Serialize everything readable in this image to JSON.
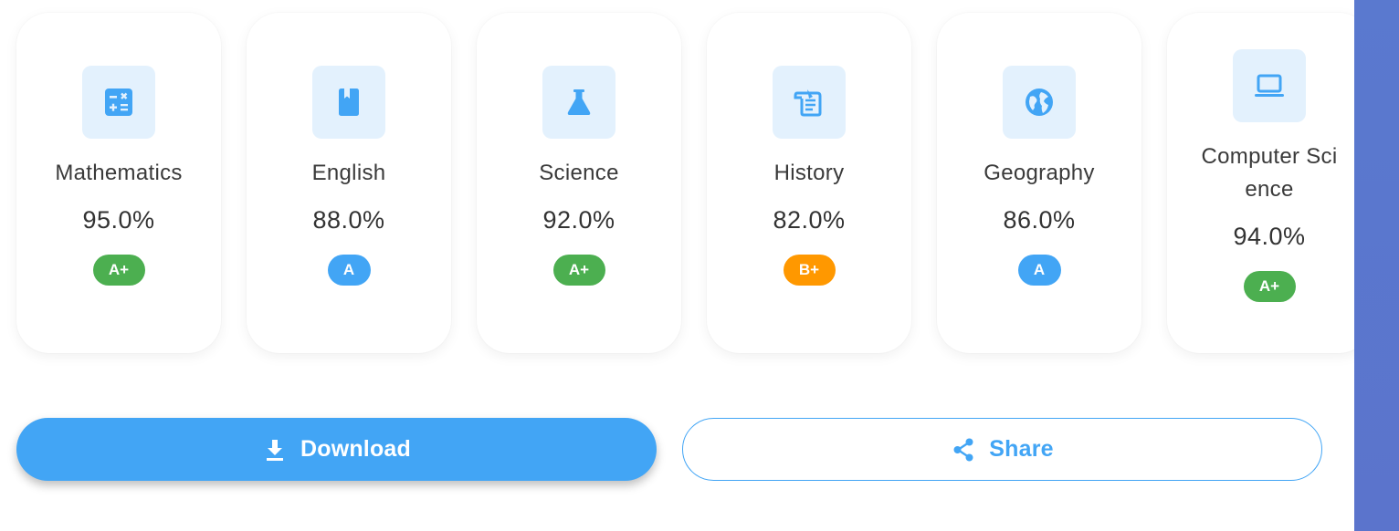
{
  "colors": {
    "accent": "#42a5f5",
    "icon_bg": "#e3f1fd",
    "grade_green": "#4caf50",
    "grade_blue": "#42a5f5",
    "grade_orange": "#ff9800",
    "side_panel": "#5a79cf"
  },
  "subjects": [
    {
      "name": "Mathematics",
      "percentage": "95.0%",
      "grade": "A+",
      "grade_color": "green",
      "icon": "calculator-icon"
    },
    {
      "name": "English",
      "percentage": "88.0%",
      "grade": "A",
      "grade_color": "blue",
      "icon": "book-icon"
    },
    {
      "name": "Science",
      "percentage": "92.0%",
      "grade": "A+",
      "grade_color": "green",
      "icon": "flask-icon"
    },
    {
      "name": "History",
      "percentage": "82.0%",
      "grade": "B+",
      "grade_color": "orange",
      "icon": "scroll-icon"
    },
    {
      "name": "Geography",
      "percentage": "86.0%",
      "grade": "A",
      "grade_color": "blue",
      "icon": "globe-icon"
    },
    {
      "name": "Computer Science",
      "percentage": "94.0%",
      "grade": "A+",
      "grade_color": "green",
      "icon": "laptop-icon"
    }
  ],
  "actions": {
    "download_label": "Download",
    "download_icon": "download-icon",
    "share_label": "Share",
    "share_icon": "share-icon"
  }
}
